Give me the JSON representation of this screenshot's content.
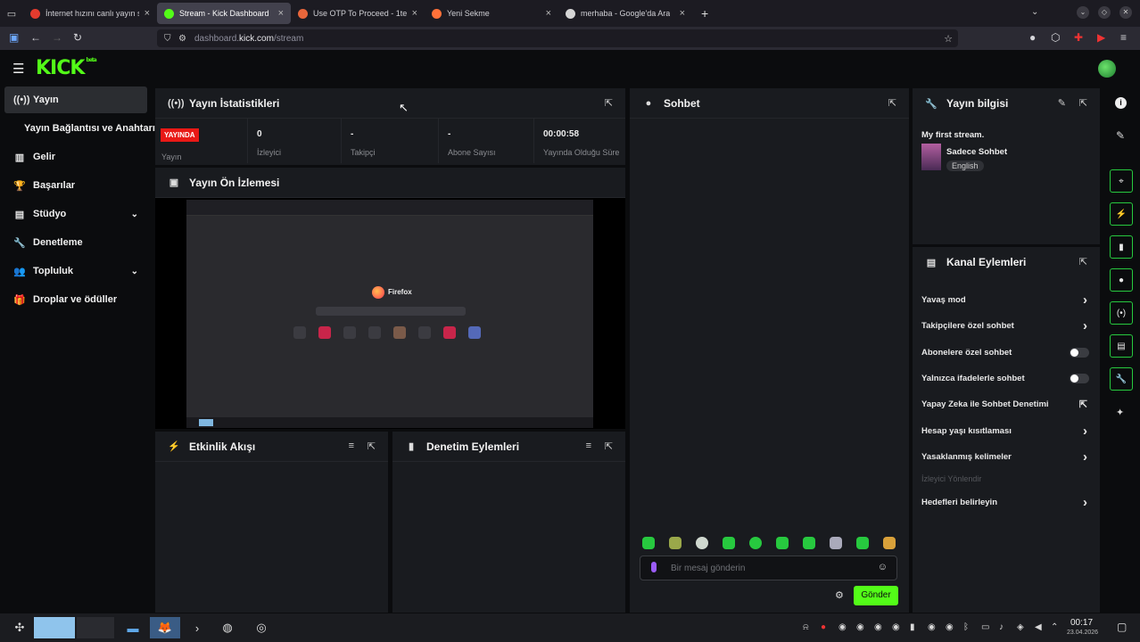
{
  "browser": {
    "tabs": [
      {
        "label": "İnternet hızını canlı yayın s",
        "favicon_color": "#e33b2e",
        "active": false
      },
      {
        "label": "Stream - Kick Dashboard",
        "favicon_color": "#53fc18",
        "active": true
      },
      {
        "label": "Use OTP To Proceed - 1tera",
        "favicon_color": "#e8663b",
        "active": false
      },
      {
        "label": "Yeni Sekme",
        "favicon_color": "#ff7139",
        "active": false
      },
      {
        "label": "merhaba - Google'da Ara",
        "favicon_color": "#d5d5d5",
        "active": false
      }
    ],
    "new_tab_symbol": "+",
    "url_prefix": "dashboard.",
    "url_domain": "kick.com",
    "url_path": "/stream"
  },
  "kick": {
    "logo_text": "KICK",
    "logo_sup": "beta",
    "accent": "#53fc18"
  },
  "sidebar": {
    "items": [
      {
        "label": "Yayın",
        "icon": "broadcast-icon",
        "glyph": "((•))",
        "active": true
      },
      {
        "label": "Yayın Bağlantısı ve Anahtarı",
        "icon": "",
        "glyph": "",
        "indent": true
      },
      {
        "label": "Gelir",
        "icon": "chart-icon",
        "glyph": "▥"
      },
      {
        "label": "Başarılar",
        "icon": "trophy-icon",
        "glyph": "🏆"
      },
      {
        "label": "Stüdyo",
        "icon": "studio-icon",
        "glyph": "▤",
        "chevron": true
      },
      {
        "label": "Denetleme",
        "icon": "wrench-icon",
        "glyph": "🔧"
      },
      {
        "label": "Topluluk",
        "icon": "community-icon",
        "glyph": "👥",
        "chevron": true
      },
      {
        "label": "Droplar ve ödüller",
        "icon": "drops-icon",
        "glyph": "🎁"
      }
    ]
  },
  "stats": {
    "title": "Yayın İstatistikleri",
    "live_badge": "YAYINDA",
    "live_label": "Yayın",
    "columns": [
      {
        "value": "0",
        "label": "İzleyici"
      },
      {
        "value": "-",
        "label": "Takipçi"
      },
      {
        "value": "-",
        "label": "Abone Sayısı"
      },
      {
        "value": "00:00:58",
        "label": "Yayında Olduğu Süre"
      }
    ]
  },
  "preview": {
    "title": "Yayın Ön İzlemesi",
    "inner_brand": "Firefox"
  },
  "activity": {
    "title": "Etkinlik Akışı"
  },
  "moderation": {
    "title": "Denetim Eylemleri"
  },
  "chat": {
    "title": "Sohbet",
    "placeholder": "Bir mesaj gönderin",
    "send_label": "Gönder"
  },
  "stream_info": {
    "title": "Yayın bilgisi",
    "stream_title": "My first stream.",
    "category": "Sadece Sohbet",
    "language": "English"
  },
  "channel_actions": {
    "title": "Kanal Eylemleri",
    "items": [
      {
        "label": "Yavaş mod",
        "control": "chevron"
      },
      {
        "label": "Takipçilere özel sohbet",
        "control": "chevron"
      },
      {
        "label": "Abonelere özel sohbet",
        "control": "toggle"
      },
      {
        "label": "Yalnızca ifadelerle sohbet",
        "control": "toggle"
      },
      {
        "label": "Yapay Zeka ile Sohbet Denetimi",
        "control": "external"
      },
      {
        "label": "Hesap yaşı kısıtlaması",
        "control": "chevron"
      },
      {
        "label": "Yasaklanmış kelimeler",
        "control": "chevron"
      },
      {
        "label": "İzleyici Yönlendir",
        "control": "none",
        "disabled": true
      },
      {
        "label": "Hedefleri belirleyin",
        "control": "chevron"
      }
    ]
  },
  "taskbar": {
    "time": "00:17",
    "date": "23.04.2026"
  }
}
